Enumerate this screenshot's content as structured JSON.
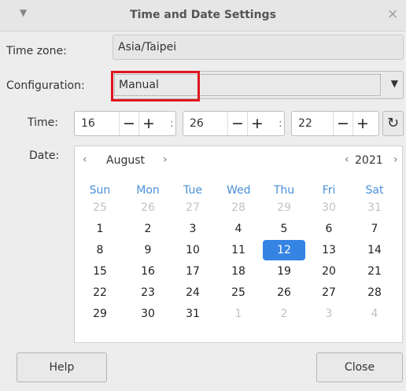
{
  "window": {
    "title": "Time and Date Settings",
    "menu_icon": "chevron-down-icon",
    "close_icon": "close-icon",
    "close_glyph": "×"
  },
  "timezone": {
    "label": "Time zone:",
    "value": "Asia/Taipei"
  },
  "configuration": {
    "label": "Configuration:",
    "value": "Manual",
    "highlight_color": "#e0141e"
  },
  "time": {
    "label": "Time:",
    "hour": "16",
    "minute": "26",
    "second": "22",
    "separator": ":",
    "minus": "−",
    "plus": "+",
    "refresh_icon": "refresh-icon",
    "refresh_glyph": "↻"
  },
  "date": {
    "label": "Date:",
    "month": "August",
    "year": "2021",
    "prev_arrow": "‹",
    "next_arrow": "›",
    "weekdays": [
      "Sun",
      "Mon",
      "Tue",
      "Wed",
      "Thu",
      "Fri",
      "Sat"
    ],
    "weeks": [
      [
        "25",
        "26",
        "27",
        "28",
        "29",
        "30",
        "31"
      ],
      [
        "1",
        "2",
        "3",
        "4",
        "5",
        "6",
        "7"
      ],
      [
        "8",
        "9",
        "10",
        "11",
        "12",
        "13",
        "14"
      ],
      [
        "15",
        "16",
        "17",
        "18",
        "19",
        "20",
        "21"
      ],
      [
        "22",
        "23",
        "24",
        "25",
        "26",
        "27",
        "28"
      ],
      [
        "29",
        "30",
        "31",
        "1",
        "2",
        "3",
        "4"
      ]
    ],
    "selected_day": "12",
    "accent_color": "#3584e4",
    "weekday_color": "#4a90d9"
  },
  "buttons": {
    "help": "Help",
    "close": "Close"
  }
}
